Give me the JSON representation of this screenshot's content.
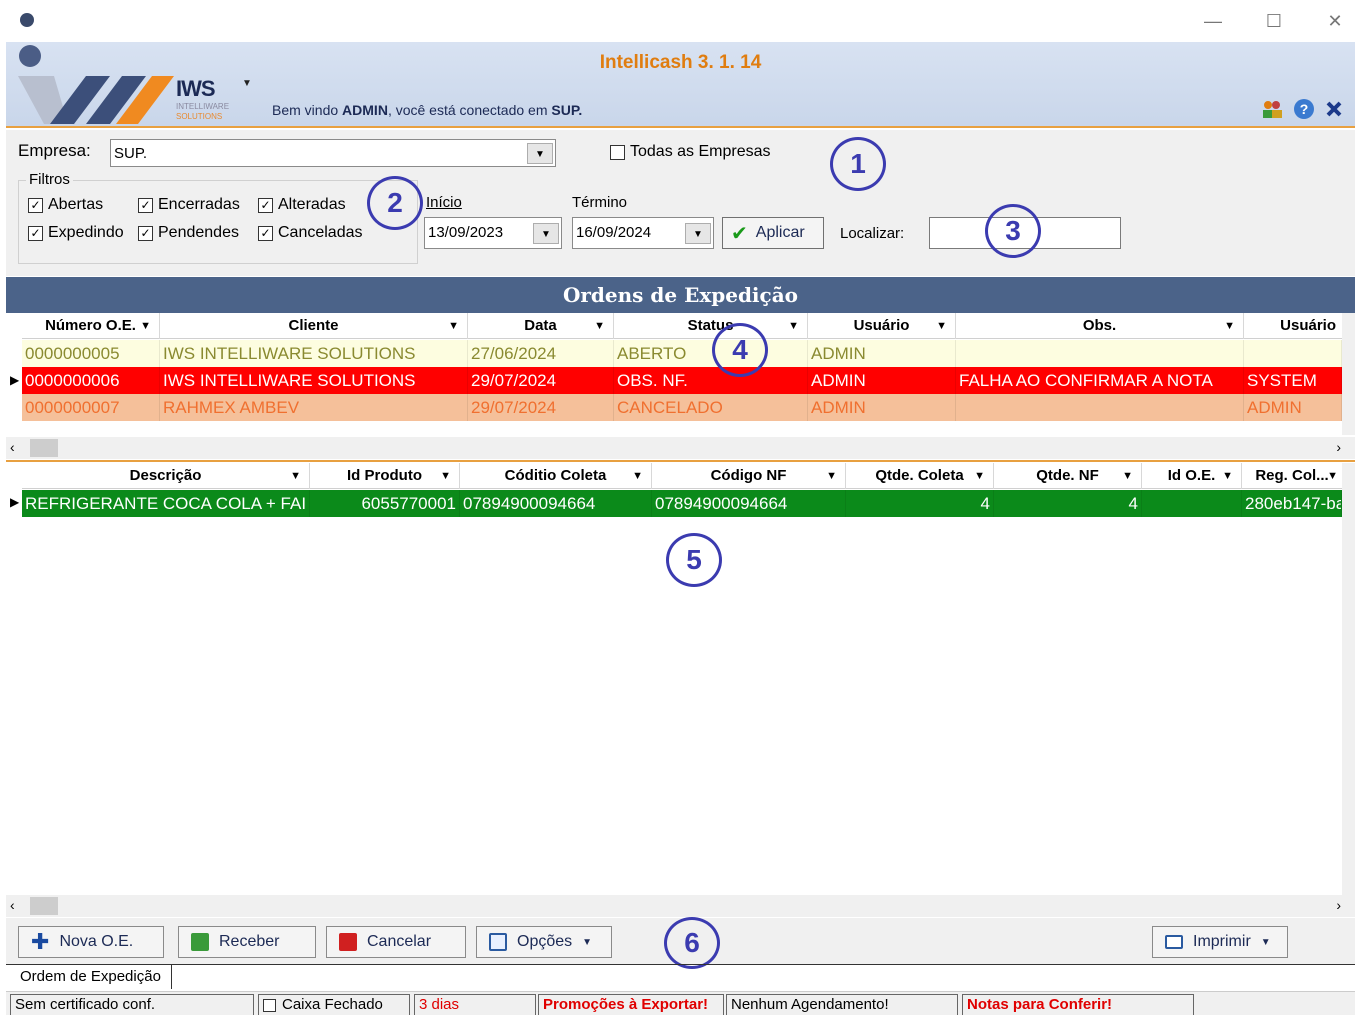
{
  "window": {
    "minimize": "—",
    "maximize": "☐",
    "close": "✕"
  },
  "header": {
    "brand": "IWS",
    "brand_sub1": "INTELLIWARE",
    "brand_sub2": "SOLUTIONS",
    "app_title": "Intellicash 3. 1. 14",
    "welcome_prefix": "Bem vindo ",
    "welcome_user": "ADMIN",
    "welcome_mid": ", você está conectado em ",
    "welcome_company": "SUP."
  },
  "filters": {
    "empresa_label": "Empresa:",
    "empresa_value": "SUP.",
    "todas_empresas": "Todas as Empresas",
    "group_title": "Filtros",
    "checks": {
      "abertas": "Abertas",
      "encerradas": "Encerradas",
      "alteradas": "Alteradas",
      "expedindo": "Expedindo",
      "pendendes": "Pendendes",
      "canceladas": "Canceladas"
    },
    "inicio_label": "Início",
    "inicio_value": "13/09/2023",
    "termino_label": "Término",
    "termino_value": "16/09/2024",
    "aplicar": "Aplicar",
    "localizar_label": "Localizar:",
    "localizar_value": ""
  },
  "badges": {
    "b1": "1",
    "b2": "2",
    "b3": "3",
    "b4": "4",
    "b5": "5",
    "b6": "6"
  },
  "orders": {
    "title": "Ordens de Expedição",
    "columns": [
      "Número O.E.",
      "Cliente",
      "Data",
      "Status",
      "Usuário",
      "Obs.",
      "Usuário"
    ],
    "rows": [
      {
        "numero": "0000000005",
        "cliente": "IWS INTELLIWARE SOLUTIONS",
        "data": "27/06/2024",
        "status": "ABERTO",
        "usuario": "ADMIN",
        "obs": "",
        "usuario2": ""
      },
      {
        "numero": "0000000006",
        "cliente": "IWS INTELLIWARE SOLUTIONS",
        "data": "29/07/2024",
        "status": "OBS. NF.",
        "usuario": "ADMIN",
        "obs": "FALHA AO CONFIRMAR A NOTA",
        "usuario2": "SYSTEM"
      },
      {
        "numero": "0000000007",
        "cliente": "RAHMEX AMBEV",
        "data": "29/07/2024",
        "status": "CANCELADO",
        "usuario": "ADMIN",
        "obs": "",
        "usuario2": "ADMIN"
      }
    ]
  },
  "items": {
    "columns": [
      "Descrição",
      "Id Produto",
      "Códitio Coleta",
      "Código NF",
      "Qtde. Coleta",
      "Qtde. NF",
      "Id O.E.",
      "Reg. Col..."
    ],
    "rows": [
      {
        "descricao": "REFRIGERANTE COCA COLA + FAI",
        "id_produto": "6055770001",
        "codigo_coleta": "07894900094664",
        "codigo_nf": "07894900094664",
        "qtde_coleta": "4",
        "qtde_nf": "4",
        "id_oe": "",
        "reg_col": "280eb147-ba"
      }
    ]
  },
  "toolbar": {
    "nova": "Nova O.E.",
    "receber": "Receber",
    "cancelar": "Cancelar",
    "opcoes": "Opções",
    "imprimir": "Imprimir"
  },
  "tab": {
    "label": "Ordem de Expedição"
  },
  "status": {
    "cert": "Sem certificado conf.",
    "caixa": "Caixa Fechado",
    "dias": "3 dias",
    "promocoes": "Promoções à Exportar!",
    "agendamento": "Nenhum Agendamento!",
    "notas": "Notas para Conferir!"
  },
  "colors": {
    "header_blue": "#4b6389",
    "row_open": "#fdfde0",
    "row_selected": "#ff0000",
    "row_cancel": "#f5c09a",
    "row_item": "#0b8a1a",
    "accent_orange": "#e07d10",
    "badge": "#3b3bb0"
  }
}
